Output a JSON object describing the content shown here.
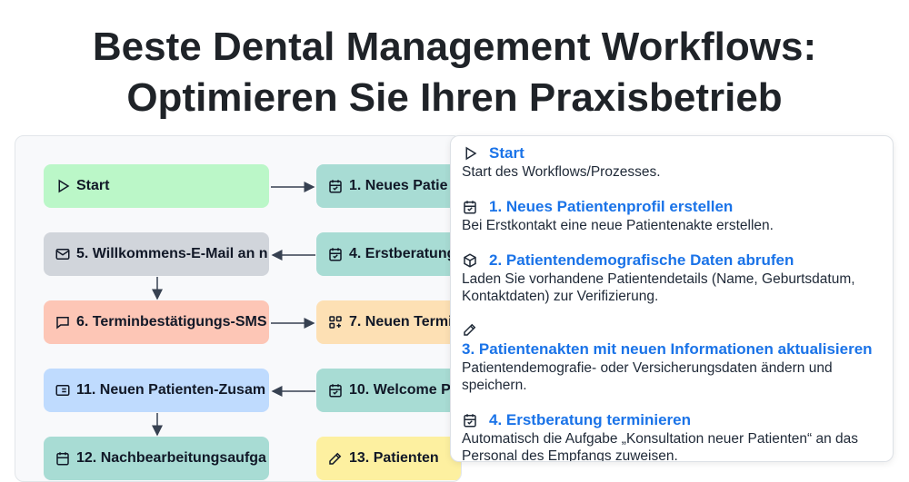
{
  "page_title_line1": "Beste Dental Management Workflows:",
  "page_title_line2": "Optimieren Sie Ihren Praxisbetrieb",
  "nodes": {
    "start": {
      "label": "Start",
      "icon": "play-icon",
      "color": "#bbf7c8"
    },
    "n1": {
      "label": "1. Neues Patie",
      "icon": "calendar-check-icon",
      "color": "#a8dcd4"
    },
    "n5": {
      "label": "5. Willkommens-E-Mail an n",
      "icon": "mail-icon",
      "color": "#d1d5db"
    },
    "n4": {
      "label": "4. Erstberatung",
      "icon": "calendar-check-icon",
      "color": "#a8dcd4"
    },
    "n6": {
      "label": "6. Terminbestätigungs-SMS",
      "icon": "message-sms-icon",
      "color": "#fdc6b6"
    },
    "n7": {
      "label": "7. Neuen Termi",
      "icon": "grid-plus-icon",
      "color": "#fde0b4"
    },
    "n11": {
      "label": "11. Neuen Patienten-Zusam",
      "icon": "id-card-icon",
      "color": "#bfdbfe"
    },
    "n10": {
      "label": "10. Welcome P",
      "icon": "calendar-check-icon",
      "color": "#a8dcd4"
    },
    "n12": {
      "label": "12. Nachbearbeitungsaufga",
      "icon": "calendar-icon",
      "color": "#a8dcd4"
    },
    "n13": {
      "label": "13. Patienten",
      "icon": "edit-icon",
      "color": "#fdf0a0"
    }
  },
  "details": [
    {
      "icon": "play-icon",
      "title": "Start",
      "desc": "Start des Workflows/Prozesses."
    },
    {
      "icon": "calendar-check-icon",
      "title": "1. Neues Patientenprofil erstellen",
      "desc": "Bei Erstkontakt eine neue Patientenakte erstellen."
    },
    {
      "icon": "cube-icon",
      "title": "2. Patientendemografische Daten abrufen",
      "desc": "Laden Sie vorhandene Patientendetails (Name, Geburtsdatum, Kontaktdaten) zur Verifizierung."
    },
    {
      "icon": "edit-icon",
      "title": "3. Patientenakten mit neuen Informationen aktualisieren",
      "desc": "Patientendemografie- oder Versicherungsdaten ändern und speichern."
    },
    {
      "icon": "calendar-check-icon",
      "title": "4. Erstberatung terminieren",
      "desc": "Automatisch die Aufgabe „Konsultation neuer Patienten“ an das Personal des Empfangs zuweisen."
    }
  ]
}
